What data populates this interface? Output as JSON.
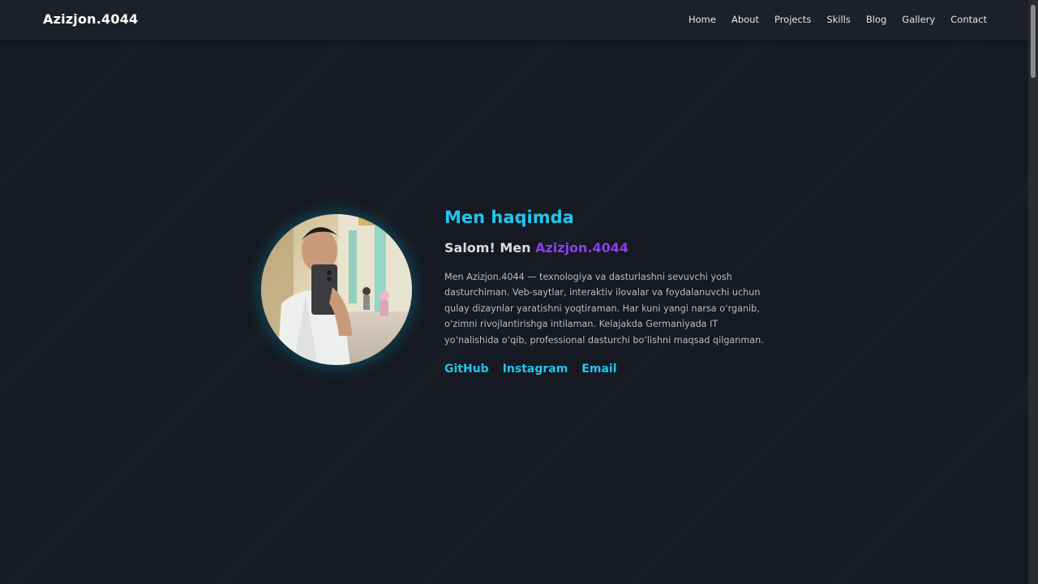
{
  "header": {
    "brand": "Azizjon.4044",
    "nav": [
      "Home",
      "About",
      "Projects",
      "Skills",
      "Blog",
      "Gallery",
      "Contact"
    ]
  },
  "about": {
    "title": "Men haqimda",
    "greeting_prefix": "Salom! Men",
    "greeting_name": "Azizjon.4044",
    "bio": "Men Azizjon.4044 — texnologiya va dasturlashni sevuvchi yosh dasturchiman. Veb-saytlar, interaktiv ilovalar va foydalanuvchi uchun qulay dizaynlar yaratishni yoqtiraman. Har kuni yangi narsa o‘rganib, o‘zimni rivojlantirishga intilaman. Kelajakda Germaniyada IT yo‘nalishida o‘qib, professional dasturchi bo‘lishni maqsad qilganman.",
    "links": [
      "GitHub",
      "Instagram",
      "Email"
    ]
  },
  "colors": {
    "accent": "#1fc6ee",
    "name_accent": "#8a3ff0",
    "background": "#151921",
    "navbar": "#1d2028"
  }
}
